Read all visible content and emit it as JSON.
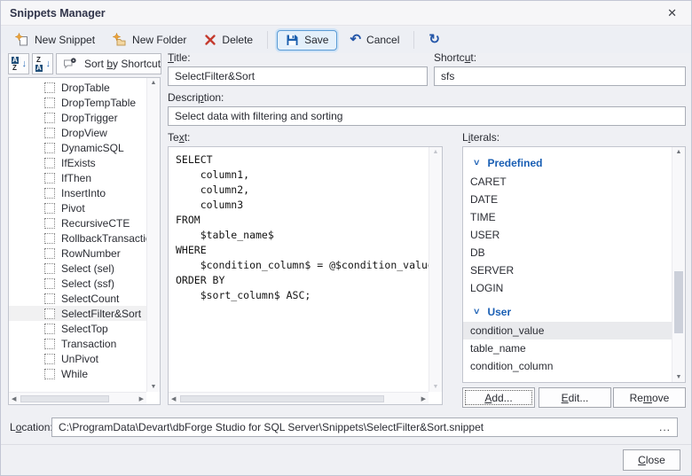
{
  "window": {
    "title": "Snippets Manager"
  },
  "icons": {
    "close": "✕",
    "cancel": "↶",
    "refresh": "↻",
    "scroll_up": "▲",
    "scroll_down": "▼",
    "scroll_left": "◀",
    "scroll_right": "▶",
    "sort_arrow": "↓",
    "chevron_down": "˅"
  },
  "toolbar": {
    "new_snippet": "New Snippet",
    "new_folder": "New Folder",
    "delete": "Delete",
    "save": "Save",
    "cancel": "Cancel"
  },
  "sortbar": {
    "az": {
      "top": "A",
      "bottom": "Z"
    },
    "za": {
      "top": "Z",
      "bottom": "A"
    },
    "sort_by": {
      "pre": "Sort ",
      "accel": "b",
      "post": "y Shortcut"
    }
  },
  "tree": {
    "items": [
      "DropTable",
      "DropTempTable",
      "DropTrigger",
      "DropView",
      "DynamicSQL",
      "IfExists",
      "IfThen",
      "InsertInto",
      "Pivot",
      "RecursiveCTE",
      "RollbackTransaction",
      "RowNumber",
      "Select (sel)",
      "Select (ssf)",
      "SelectCount",
      "SelectFilter&Sort",
      "SelectTop",
      "Transaction",
      "UnPivot",
      "While"
    ],
    "selected_item": "SelectFilter&Sort"
  },
  "labels": {
    "title": {
      "pre": "",
      "accel": "T",
      "post": "itle:"
    },
    "shortcut": {
      "pre": "Shortc",
      "accel": "u",
      "post": "t:"
    },
    "description": {
      "pre": "Descri",
      "accel": "p",
      "post": "tion:"
    },
    "text": {
      "pre": "Te",
      "accel": "x",
      "post": "t:"
    },
    "literals": {
      "pre": "L",
      "accel": "i",
      "post": "terals:"
    },
    "location": {
      "pre": "L",
      "accel": "o",
      "post": "cation:"
    }
  },
  "fields": {
    "title_value": "SelectFilter&Sort",
    "shortcut_value": "sfs",
    "description_value": "Select data with filtering and sorting"
  },
  "code": {
    "lines": [
      "SELECT",
      "    column1,",
      "    column2,",
      "    column3",
      "FROM",
      "    $table_name$",
      "WHERE",
      "    $condition_column$ = @$condition_value$;",
      "ORDER BY",
      "    $sort_column$ ASC;"
    ]
  },
  "literals": {
    "groups": [
      {
        "name": "Predefined",
        "items": [
          "CARET",
          "DATE",
          "TIME",
          "USER",
          "DB",
          "SERVER",
          "LOGIN"
        ]
      },
      {
        "name": "User",
        "items": [
          "condition_value",
          "table_name",
          "condition_column"
        ]
      }
    ],
    "selected_item": "condition_value"
  },
  "buttons": {
    "add": {
      "pre": "",
      "accel": "A",
      "post": "dd..."
    },
    "edit": {
      "pre": "",
      "accel": "E",
      "post": "dit..."
    },
    "remove": {
      "pre": "Re",
      "accel": "m",
      "post": "ove"
    },
    "close": {
      "pre": "",
      "accel": "C",
      "post": "lose"
    }
  },
  "location": {
    "path": "C:\\ProgramData\\Devart\\dbForge Studio for SQL Server\\Snippets\\SelectFilter&Sort.snippet",
    "browse": "..."
  },
  "colors": {
    "accent_blue": "#1a5fb4",
    "save_highlight_border": "#5b9bd5",
    "save_highlight_bg": "#e4f0fb",
    "delete_red": "#c43b2e",
    "star_orange": "#f0a63a"
  }
}
